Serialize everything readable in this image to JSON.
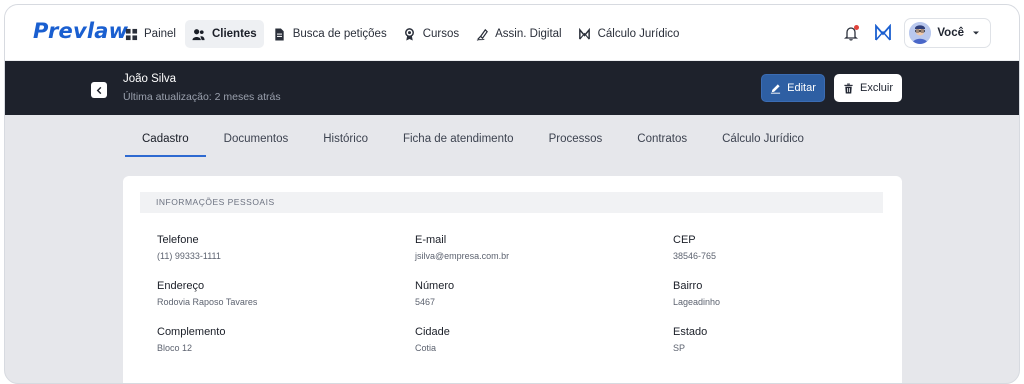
{
  "brand": {
    "logo_text": "Prevlaw",
    "accent": "#1a5fd0"
  },
  "nav": {
    "items": [
      {
        "label": "Painel",
        "icon": "grid-icon"
      },
      {
        "label": "Clientes",
        "icon": "users-icon",
        "active": true
      },
      {
        "label": "Busca de petições",
        "icon": "document-icon"
      },
      {
        "label": "Cursos",
        "icon": "award-icon"
      },
      {
        "label": "Assin. Digital",
        "icon": "signature-icon"
      },
      {
        "label": "Cálculo Jurídico",
        "icon": "m-logo-icon"
      }
    ]
  },
  "user": {
    "label": "Você",
    "icons": [
      "bell-icon",
      "m-logo-icon",
      "avatar",
      "chevron-down-icon"
    ]
  },
  "client": {
    "name": "João Silva",
    "last_update": "Última atualização: 2 meses atrás",
    "edit_label": "Editar",
    "delete_label": "Excluir"
  },
  "tabs": [
    {
      "label": "Cadastro",
      "active": true
    },
    {
      "label": "Documentos"
    },
    {
      "label": "Histórico"
    },
    {
      "label": "Ficha de atendimento"
    },
    {
      "label": "Processos"
    },
    {
      "label": "Contratos"
    },
    {
      "label": "Cálculo Jurídico"
    }
  ],
  "section": {
    "title": "INFORMAÇÕES PESSOAIS",
    "fields": [
      {
        "label": "Telefone",
        "value": "(11) 99333-1111"
      },
      {
        "label": "E-mail",
        "value": "jsilva@empresa.com.br"
      },
      {
        "label": "CEP",
        "value": "38546-765"
      },
      {
        "label": "Endereço",
        "value": "Rodovia Raposo Tavares"
      },
      {
        "label": "Número",
        "value": "5467"
      },
      {
        "label": "Bairro",
        "value": "Lageadinho"
      },
      {
        "label": "Complemento",
        "value": "Bloco 12"
      },
      {
        "label": "Cidade",
        "value": "Cotia"
      },
      {
        "label": "Estado",
        "value": "SP"
      }
    ]
  }
}
